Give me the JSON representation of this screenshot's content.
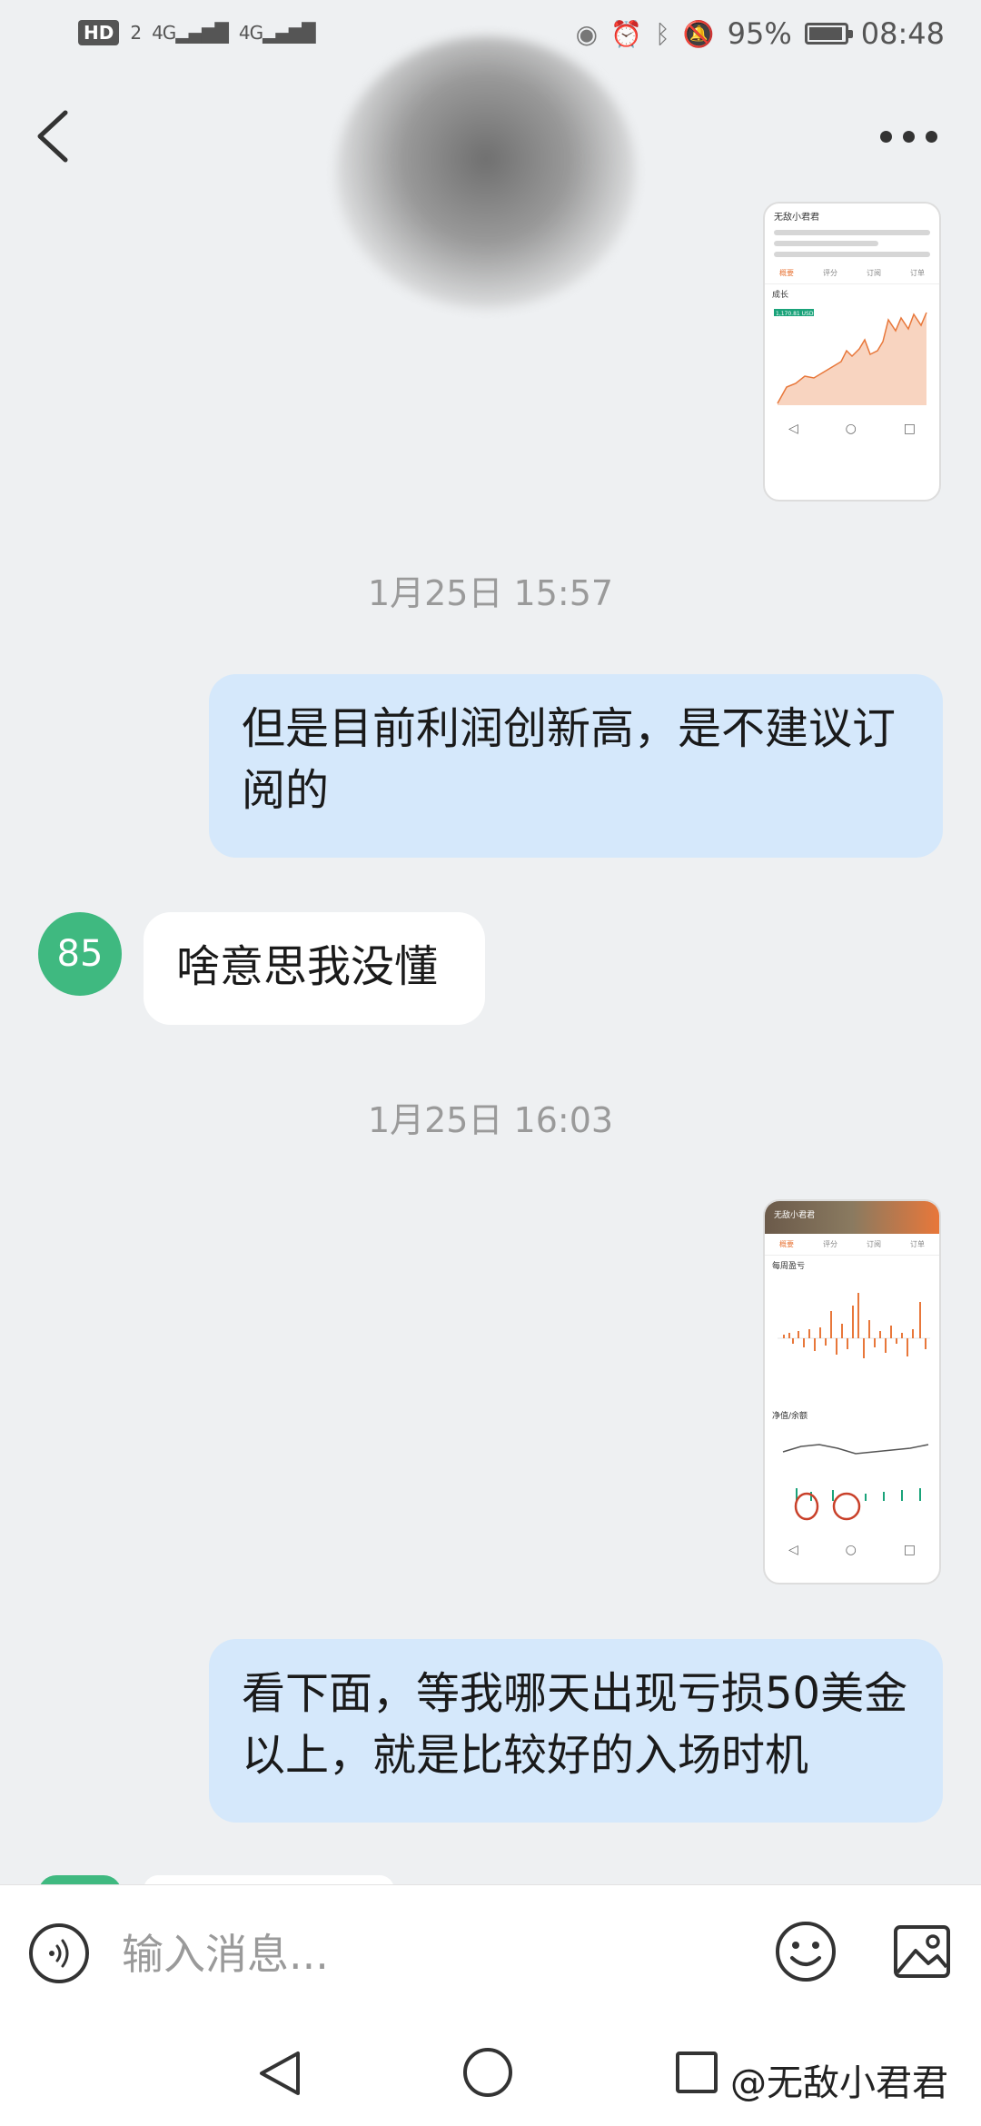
{
  "status_bar": {
    "hd": "HD",
    "sim_slot": "2",
    "signal_1": "4G",
    "signal_2": "4G",
    "battery": "95%",
    "battery_level": 0.95,
    "time": "08:48"
  },
  "header": {
    "back_icon": "chevron-left-icon",
    "more_icon": "more-dots-icon"
  },
  "messages": {
    "ts1": "1月25日 15:57",
    "bubble1": "但是目前利润创新高，是不建议订阅的",
    "avatar_label": "85",
    "bubble2": "啥意思我没懂",
    "ts2": "1月25日 16:03",
    "bubble3": "看下面，等我哪天出现亏损50美金以上，就是比较好的入场时机"
  },
  "image1": {
    "name": "无敌小君君",
    "tabs": [
      "概要",
      "评分",
      "订阅",
      "订单"
    ],
    "section": "成长",
    "value_tag": "1,170.81 USD"
  },
  "image2": {
    "name": "无敌小君君",
    "tabs": [
      "概要",
      "评分",
      "订阅",
      "订单"
    ],
    "section1": "每周盈亏",
    "section2": "净值/余额"
  },
  "input": {
    "placeholder": "输入消息..."
  },
  "nav": {
    "watermark": "@无敌小君君"
  },
  "colors": {
    "bubble_self": "#d5e8fb",
    "bubble_other": "#ffffff",
    "avatar": "#3fb980",
    "background": "#eef0f2"
  }
}
